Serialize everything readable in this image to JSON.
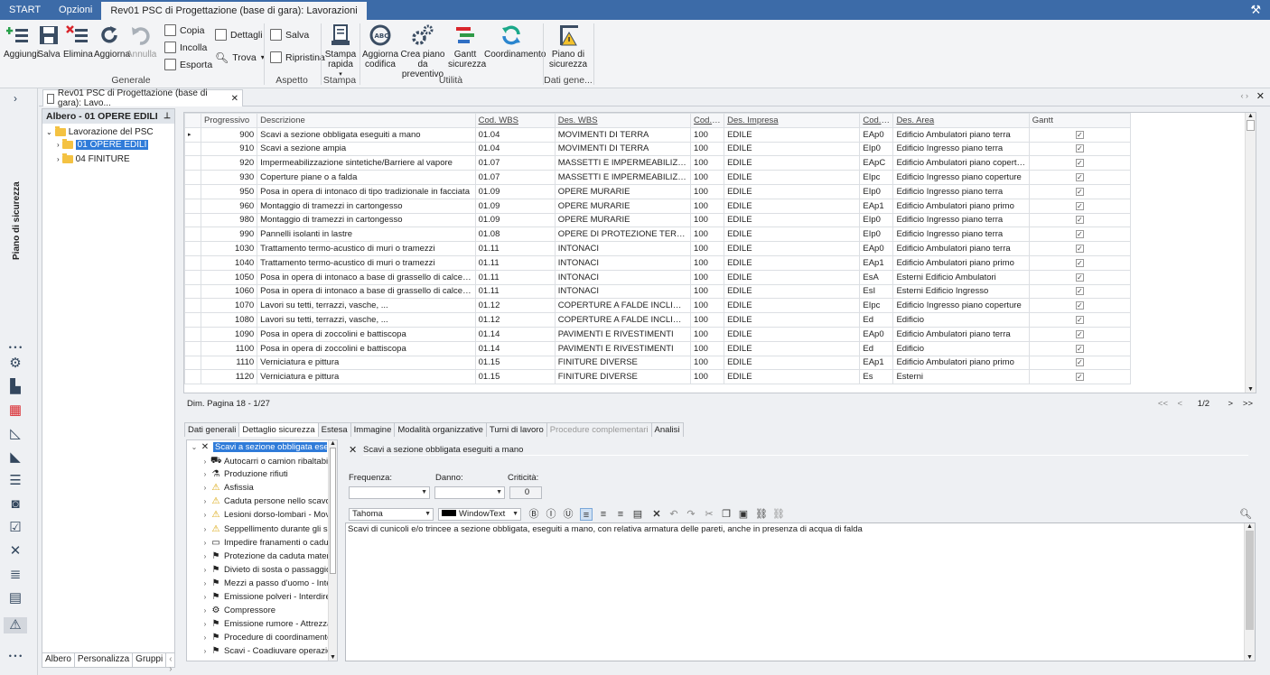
{
  "topbar": {
    "tabs": [
      "START",
      "Opzioni",
      "Rev01 PSC di Progettazione (base di gara): Lavorazioni"
    ]
  },
  "ribbon": {
    "generale": {
      "label": "Generale",
      "buttons": [
        "Aggiungi",
        "Salva",
        "Elimina",
        "Aggiorna",
        "Annulla"
      ],
      "small": [
        "Copia",
        "Incolla",
        "Esporta"
      ],
      "dettagli": "Dettagli",
      "trova": "Trova"
    },
    "aspetto": {
      "label": "Aspetto",
      "salva": "Salva",
      "ripristina": "Ripristina"
    },
    "stampa": {
      "label": "Stampa",
      "button": "Stampa rapida"
    },
    "utilita": {
      "label": "Utilità",
      "buttons": [
        "Aggiorna codifica",
        "Crea piano da preventivo",
        "Gantt sicurezza",
        "Coordinamento"
      ]
    },
    "dati": {
      "label": "Dati gene...",
      "button": "Piano di sicurezza"
    }
  },
  "leftnav": {
    "vertical_title": "Piano di sicurezza"
  },
  "doctab": {
    "title": "Rev01 PSC di Progettazione (base di gara): Lavo..."
  },
  "tree": {
    "header": "Albero - 01 OPERE EDILI",
    "root": "Lavorazione del PSC",
    "children": [
      "01 OPERE EDILI",
      "04 FINITURE"
    ],
    "tabs": [
      "Albero",
      "Personalizza",
      "Gruppi"
    ]
  },
  "grid": {
    "columns": [
      "Progressivo",
      "Descrizione",
      "Cod. WBS",
      "Des. WBS",
      "Cod. I...",
      "Des. Impresa",
      "Cod. A...",
      "Des. Area",
      "Gantt"
    ],
    "rows": [
      [
        "900",
        "Scavi a sezione obbligata eseguiti a mano",
        "01.04",
        "MOVIMENTI DI TERRA",
        "100",
        "EDILE",
        "EAp0",
        "Edificio Ambulatori piano terra"
      ],
      [
        "910",
        "Scavi a sezione ampia",
        "01.04",
        "MOVIMENTI DI TERRA",
        "100",
        "EDILE",
        "EIp0",
        "Edificio Ingresso piano terra"
      ],
      [
        "920",
        "Impermeabilizzazione sintetiche/Barriere al vapore",
        "01.07",
        "MASSETTI E IMPERMEABILIZZAZIONI",
        "100",
        "EDILE",
        "EApC",
        "Edificio Ambulatori piano coperture"
      ],
      [
        "930",
        "Coperture piane o a falda",
        "01.07",
        "MASSETTI E IMPERMEABILIZZAZIONI",
        "100",
        "EDILE",
        "EIpc",
        "Edificio Ingresso piano coperture"
      ],
      [
        "950",
        "Posa in opera di intonaco di tipo tradizionale in facciata",
        "01.09",
        "OPERE MURARIE",
        "100",
        "EDILE",
        "EIp0",
        "Edificio Ingresso piano terra"
      ],
      [
        "960",
        "Montaggio di tramezzi in cartongesso",
        "01.09",
        "OPERE MURARIE",
        "100",
        "EDILE",
        "EAp1",
        "Edificio Ambulatori piano primo"
      ],
      [
        "980",
        "Montaggio di tramezzi in cartongesso",
        "01.09",
        "OPERE MURARIE",
        "100",
        "EDILE",
        "EIp0",
        "Edificio Ingresso piano terra"
      ],
      [
        "990",
        "Pannelli isolanti in lastre",
        "01.08",
        "OPERE DI PROTEZIONE TERMICA E A...",
        "100",
        "EDILE",
        "EIp0",
        "Edificio Ingresso piano terra"
      ],
      [
        "1030",
        "Trattamento termo-acustico di muri o tramezzi",
        "01.11",
        "INTONACI",
        "100",
        "EDILE",
        "EAp0",
        "Edificio Ambulatori piano terra"
      ],
      [
        "1040",
        "Trattamento termo-acustico di muri o tramezzi",
        "01.11",
        "INTONACI",
        "100",
        "EDILE",
        "EAp1",
        "Edificio Ambulatori piano primo"
      ],
      [
        "1050",
        "Posa in opera di intonaco a base di grassello di calce preconfezi...",
        "01.11",
        "INTONACI",
        "100",
        "EDILE",
        "EsA",
        "Esterni Edificio Ambulatori"
      ],
      [
        "1060",
        "Posa in opera di intonaco a base di grassello di calce preconfezi...",
        "01.11",
        "INTONACI",
        "100",
        "EDILE",
        "EsI",
        "Esterni Edificio Ingresso"
      ],
      [
        "1070",
        "Lavori su tetti, terrazzi, vasche, ...",
        "01.12",
        "COPERTURE A FALDE INCLINATE",
        "100",
        "EDILE",
        "EIpc",
        "Edificio Ingresso piano coperture"
      ],
      [
        "1080",
        "Lavori su tetti, terrazzi, vasche, ...",
        "01.12",
        "COPERTURE A FALDE INCLINATE",
        "100",
        "EDILE",
        "Ed",
        "Edificio"
      ],
      [
        "1090",
        "Posa in opera di zoccolini e battiscopa",
        "01.14",
        "PAVIMENTI E RIVESTIMENTI",
        "100",
        "EDILE",
        "EAp0",
        "Edificio Ambulatori piano terra"
      ],
      [
        "1100",
        "Posa in opera di zoccolini e battiscopa",
        "01.14",
        "PAVIMENTI E RIVESTIMENTI",
        "100",
        "EDILE",
        "Ed",
        "Edificio"
      ],
      [
        "1110",
        "Verniciatura e pittura",
        "01.15",
        "FINITURE DIVERSE",
        "100",
        "EDILE",
        "EAp1",
        "Edificio Ambulatori piano primo"
      ],
      [
        "1120",
        "Verniciatura e pittura",
        "01.15",
        "FINITURE DIVERSE",
        "100",
        "EDILE",
        "Es",
        "Esterni"
      ]
    ],
    "gantt_checked": true
  },
  "pager": {
    "info": "Dim. Pagina 18 - 1/27",
    "page": "1/2",
    "first": "<<",
    "prev": "<",
    "next": ">",
    "last": ">>"
  },
  "lower_tabs": [
    "Dati generali",
    "Dettaglio sicurezza",
    "Estesa",
    "Immagine",
    "Modalità organizzative",
    "Turni di lavoro",
    "Procedure complementari",
    "Analisi"
  ],
  "risk_tree": {
    "root": "Scavi a sezione obbligata eseguiti a mano",
    "items": [
      "Autocarri o camion ribaltabili",
      "Produzione rifiuti",
      "Asfissia",
      "Caduta persone nello scavo",
      "Lesioni dorso-lombari - Mov...",
      "Seppellimento durante gli sc...",
      "Impedire franamenti o cadu...",
      "Protezione da caduta mater...",
      "Divieto di sosta o passaggio...",
      "Mezzi a passo d'uomo - Inte...",
      "Emissione polveri - Interdire...",
      "Compressore",
      "Emissione rumore - Attrezza...",
      "Procedure di coordinamento...",
      "Scavi - Coadiuvare operazio..."
    ]
  },
  "detail": {
    "title": "Scavi a sezione obbligata eseguiti a mano",
    "frequenza_label": "Frequenza:",
    "danno_label": "Danno:",
    "criticita_label": "Criticità:",
    "criticita_value": "0",
    "font_name": "Tahoma",
    "color_name": "WindowText",
    "memo": "Scavi di cunicoli e/o trincee  a sezione obbligata, eseguiti a mano, con relativa armatura delle pareti, anche in presenza di acqua di falda"
  },
  "colors": {
    "accent": "#3c6ba8",
    "selection": "#2f7bd9"
  }
}
